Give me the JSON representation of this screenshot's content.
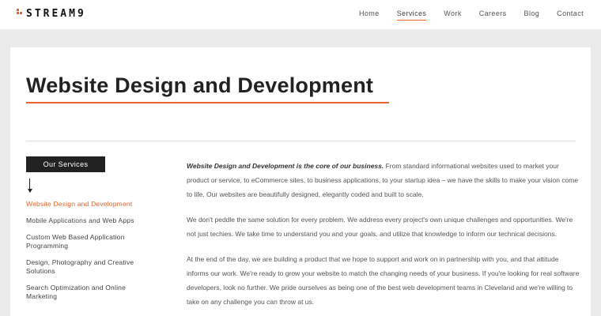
{
  "header": {
    "logo_text": "STREAM9",
    "nav": [
      {
        "label": "Home",
        "active": false
      },
      {
        "label": "Services",
        "active": true
      },
      {
        "label": "Work",
        "active": false
      },
      {
        "label": "Careers",
        "active": false
      },
      {
        "label": "Blog",
        "active": false
      },
      {
        "label": "Contact",
        "active": false
      }
    ]
  },
  "main": {
    "title": "Website Design and Development",
    "services_heading": "Our Services",
    "services": [
      {
        "label": "Website Design and Development",
        "active": true
      },
      {
        "label": "Mobile Applications and Web Apps",
        "active": false
      },
      {
        "label": "Custom Web Based Application Programming",
        "active": false
      },
      {
        "label": "Design, Photography and Creative Solutions",
        "active": false
      },
      {
        "label": "Search Optimization and Online Marketing",
        "active": false
      }
    ],
    "paragraphs": [
      {
        "lead": "Website Design and Development is the core of our business.",
        "text": " From standard informational websites used to market your product or service, to eCommerce sites, to business applications, to your startup idea – we have the skills to make your vision come to life. Our websites are beautifully designed, elegantly coded and built to scale."
      },
      {
        "lead": "",
        "text": "We don't peddle the same solution for every problem. We address every project's own unique challenges and opportunities. We're not just techies. We take time to understand you and your goals, and utilize that knowledge to inform our technical decisions."
      },
      {
        "lead": "",
        "text": "At the end of the day, we are building a product that we hope to support and work on in partnership with you, and that attitude informs our work. We're ready to grow your website to match the changing needs of your business. If you're looking for real software developers, look no further. We pride ourselves as being one of the best web development teams in Cleveland and we're willing to take on any challenge you can throw at us."
      }
    ]
  },
  "colors": {
    "accent": "#e8642c",
    "dark": "#222222",
    "page_bg": "#ebebeb"
  }
}
